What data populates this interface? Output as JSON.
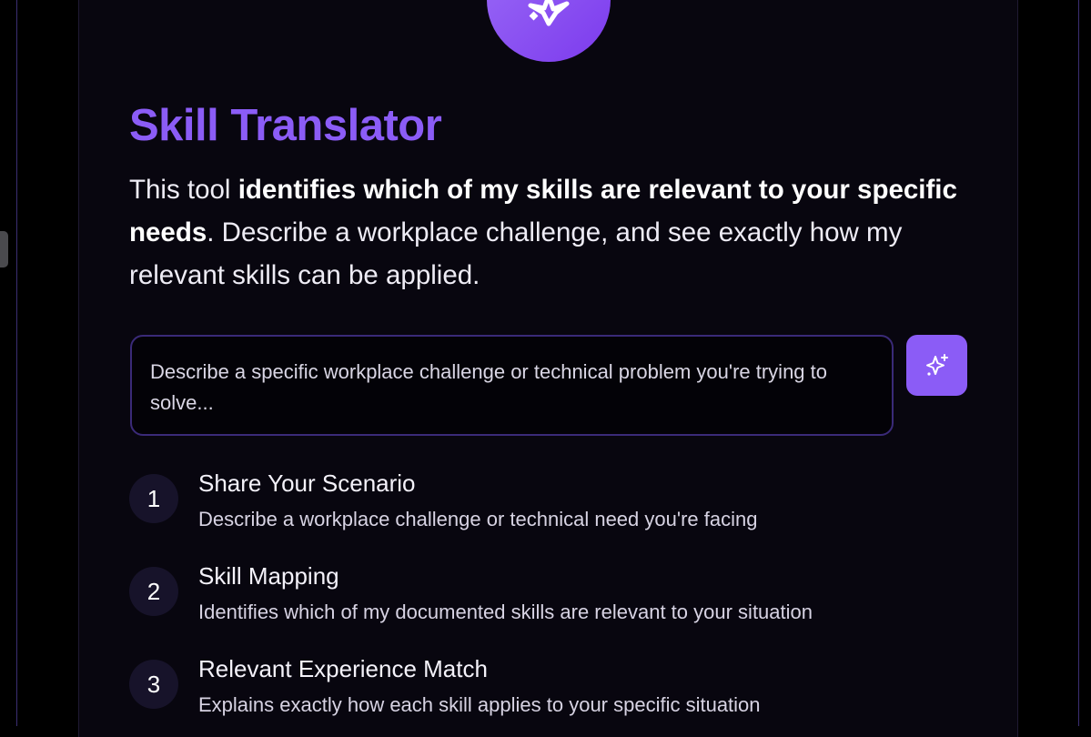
{
  "hero": {
    "icon": "sparkle-icon"
  },
  "title": "Skill Translator",
  "intro": {
    "part1": "This tool ",
    "bold": "identifies which of my skills are relevant to your specific needs",
    "part2": ". Describe a workplace challenge, and see exactly how my relevant skills can be applied."
  },
  "input": {
    "placeholder": "Describe a specific workplace challenge or technical problem you're trying to solve...",
    "value": ""
  },
  "submit": {
    "icon": "sparkles-icon"
  },
  "steps": [
    {
      "number": "1",
      "title": "Share Your Scenario",
      "description": "Describe a workplace challenge or technical need you're facing"
    },
    {
      "number": "2",
      "title": "Skill Mapping",
      "description": "Identifies which of my documented skills are relevant to your situation"
    },
    {
      "number": "3",
      "title": "Relevant Experience Match",
      "description": "Explains exactly how each skill applies to your specific situation"
    }
  ],
  "colors": {
    "accent": "#8b5cf6",
    "background": "#08060f"
  }
}
